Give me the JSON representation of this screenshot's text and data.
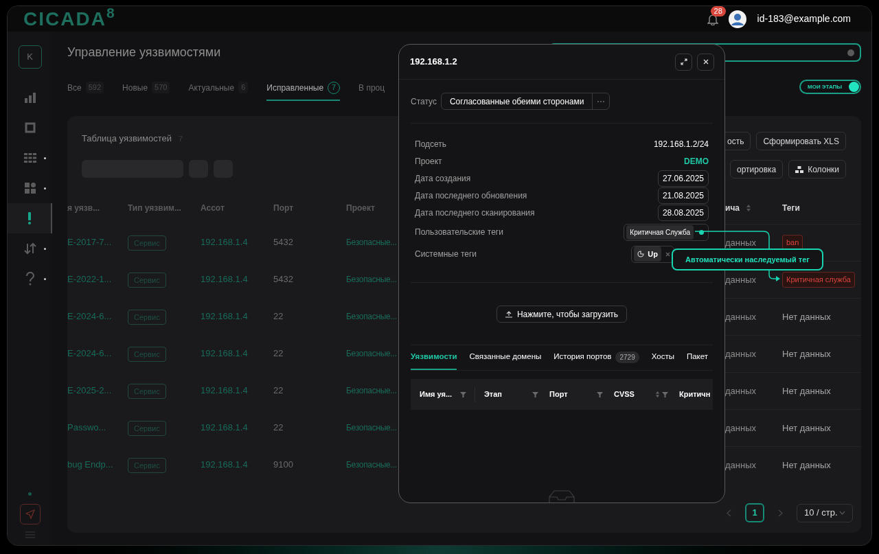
{
  "header": {
    "logo": "CICADA$^{8}$",
    "notifications": "28",
    "user_email": "id-183@example.com"
  },
  "sidebar": {
    "avatar_letter": "K",
    "items": [
      {
        "kind": "chart",
        "selected": false,
        "dot": false
      },
      {
        "kind": "square",
        "selected": false,
        "dot": false
      },
      {
        "kind": "grid",
        "selected": false,
        "dot": true
      },
      {
        "kind": "apps",
        "selected": false,
        "dot": true
      },
      {
        "kind": "alert",
        "selected": true,
        "dot": false
      },
      {
        "kind": "sort",
        "selected": false,
        "dot": true
      },
      {
        "kind": "help",
        "selected": false,
        "dot": true
      }
    ]
  },
  "page": {
    "title": "Управление уязвимостями",
    "tabs": [
      {
        "label": "Все",
        "count": "592",
        "selected": false
      },
      {
        "label": "Новые",
        "count": "570",
        "selected": false
      },
      {
        "label": "Актуальные",
        "count": "6",
        "selected": false
      },
      {
        "label": "Исправленные",
        "count": "7",
        "selected": true
      },
      {
        "label": "В проц",
        "selected": false
      }
    ],
    "toggle": {
      "label": "МОИ ЭТАПЫ",
      "on": true
    }
  },
  "card": {
    "title": "Таблица уязвимостей",
    "count": "7",
    "buttons": [
      {
        "label": "ость",
        "kind": "plain"
      },
      {
        "label": "Сформировать XLS",
        "kind": "plain"
      },
      {
        "label": "ортировка",
        "kind": "plain"
      },
      {
        "label": "Колонки",
        "kind": "columns"
      }
    ],
    "table": {
      "columns": [
        {
          "label": "я уязв...",
          "sortable": false
        },
        {
          "label": "Тип уязвим...",
          "sortable": false
        },
        {
          "label": "Ассот",
          "sortable": false
        },
        {
          "label": "Порт",
          "sortable": false
        },
        {
          "label": "Проект",
          "sortable": false
        },
        {
          "label": "ича",
          "sortable": true
        },
        {
          "label": "Теги",
          "sortable": false
        }
      ],
      "rows": [
        {
          "name": "E-2017-7...",
          "type": "Сервис",
          "asset": "192.168.1.4",
          "port": "5432",
          "project": "Безопасные...",
          "column_6": "данных",
          "tags": [
            {
              "label": "ban",
              "color": "#d9453b"
            }
          ]
        },
        {
          "name": "E-2022-1...",
          "type": "Сервис",
          "asset": "192.168.1.4",
          "port": "5432",
          "project": "Безопасные...",
          "column_6": "данных",
          "tags": [
            {
              "label": "Критичная служба",
              "color": "#d9453b"
            }
          ]
        },
        {
          "name": "E-2024-6...",
          "type": "Сервис",
          "asset": "192.168.1.4",
          "port": "22",
          "project": "Безопасные...",
          "column_6": "данных",
          "tags_text": "Нет данных"
        },
        {
          "name": "E-2024-6...",
          "type": "Сервис",
          "asset": "192.168.1.4",
          "port": "22",
          "project": "Безопасные...",
          "column_6": "данных",
          "tags_text": "Нет данных"
        },
        {
          "name": "E-2025-2...",
          "type": "Сервис",
          "asset": "192.168.1.4",
          "port": "22",
          "project": "Безопасные...",
          "column_6": "данных",
          "tags_text": "Нет данных"
        },
        {
          "name": "Passwo...",
          "type": "Сервис",
          "asset": "192.168.1.4",
          "port": "22",
          "project": "Безопасные...",
          "column_6": "данных",
          "tags_text": "Нет данных"
        },
        {
          "name": "bug Endp...",
          "type": "Сервис",
          "asset": "192.168.1.4",
          "port": "9100",
          "project": "Безопасные...",
          "column_6": "данных",
          "tags_text": "Нет данных"
        }
      ]
    },
    "pagination": {
      "pages": [
        {
          "label": "1",
          "selected": true
        }
      ],
      "page_size": "10 / стр."
    }
  },
  "modal": {
    "title": "192.168.1.2",
    "status": {
      "label": "Статус",
      "value": "Согласованные обеими сторонами"
    },
    "fields": [
      {
        "label": "Подсеть",
        "kind": "text",
        "value": "192.168.1.2/24"
      },
      {
        "label": "Проект",
        "kind": "link",
        "value": "DEMO"
      },
      {
        "label": "Дата создания",
        "kind": "date",
        "value": "27.06.2025"
      },
      {
        "label": "Дата последнего обновления",
        "kind": "date",
        "value": "21.08.2025"
      },
      {
        "label": "Дата последнего сканирования",
        "kind": "date",
        "value": "28.08.2025"
      },
      {
        "label": "Пользовательские теги",
        "kind": "user_tags",
        "tags": [
          {
            "label": "Критичная Служба"
          }
        ]
      },
      {
        "label": "Системные теги",
        "kind": "system_tags",
        "tags": [
          {
            "label": "Up",
            "removable": true
          }
        ]
      }
    ],
    "upload_button": "Нажмите, чтобы загрузить",
    "tabs": [
      {
        "label": "Уязвимости",
        "selected": true
      },
      {
        "label": "Связанные домены",
        "selected": false
      },
      {
        "label": "История портов",
        "count": "2729",
        "selected": false
      },
      {
        "label": "Хосты",
        "selected": false
      },
      {
        "label": "Пакет",
        "selected": false
      }
    ],
    "columns": [
      {
        "label": "Имя уя...",
        "sortable": false,
        "filter": true
      },
      {
        "label": "Этап",
        "sortable": false,
        "filter": true
      },
      {
        "label": "Порт",
        "sortable": false,
        "filter": true
      },
      {
        "label": "CVSS",
        "sortable": true,
        "filter": true
      },
      {
        "label": "Критичн",
        "sortable": false,
        "filter": false
      }
    ]
  },
  "callout": {
    "text": "Автоматически наследуемый тег"
  }
}
